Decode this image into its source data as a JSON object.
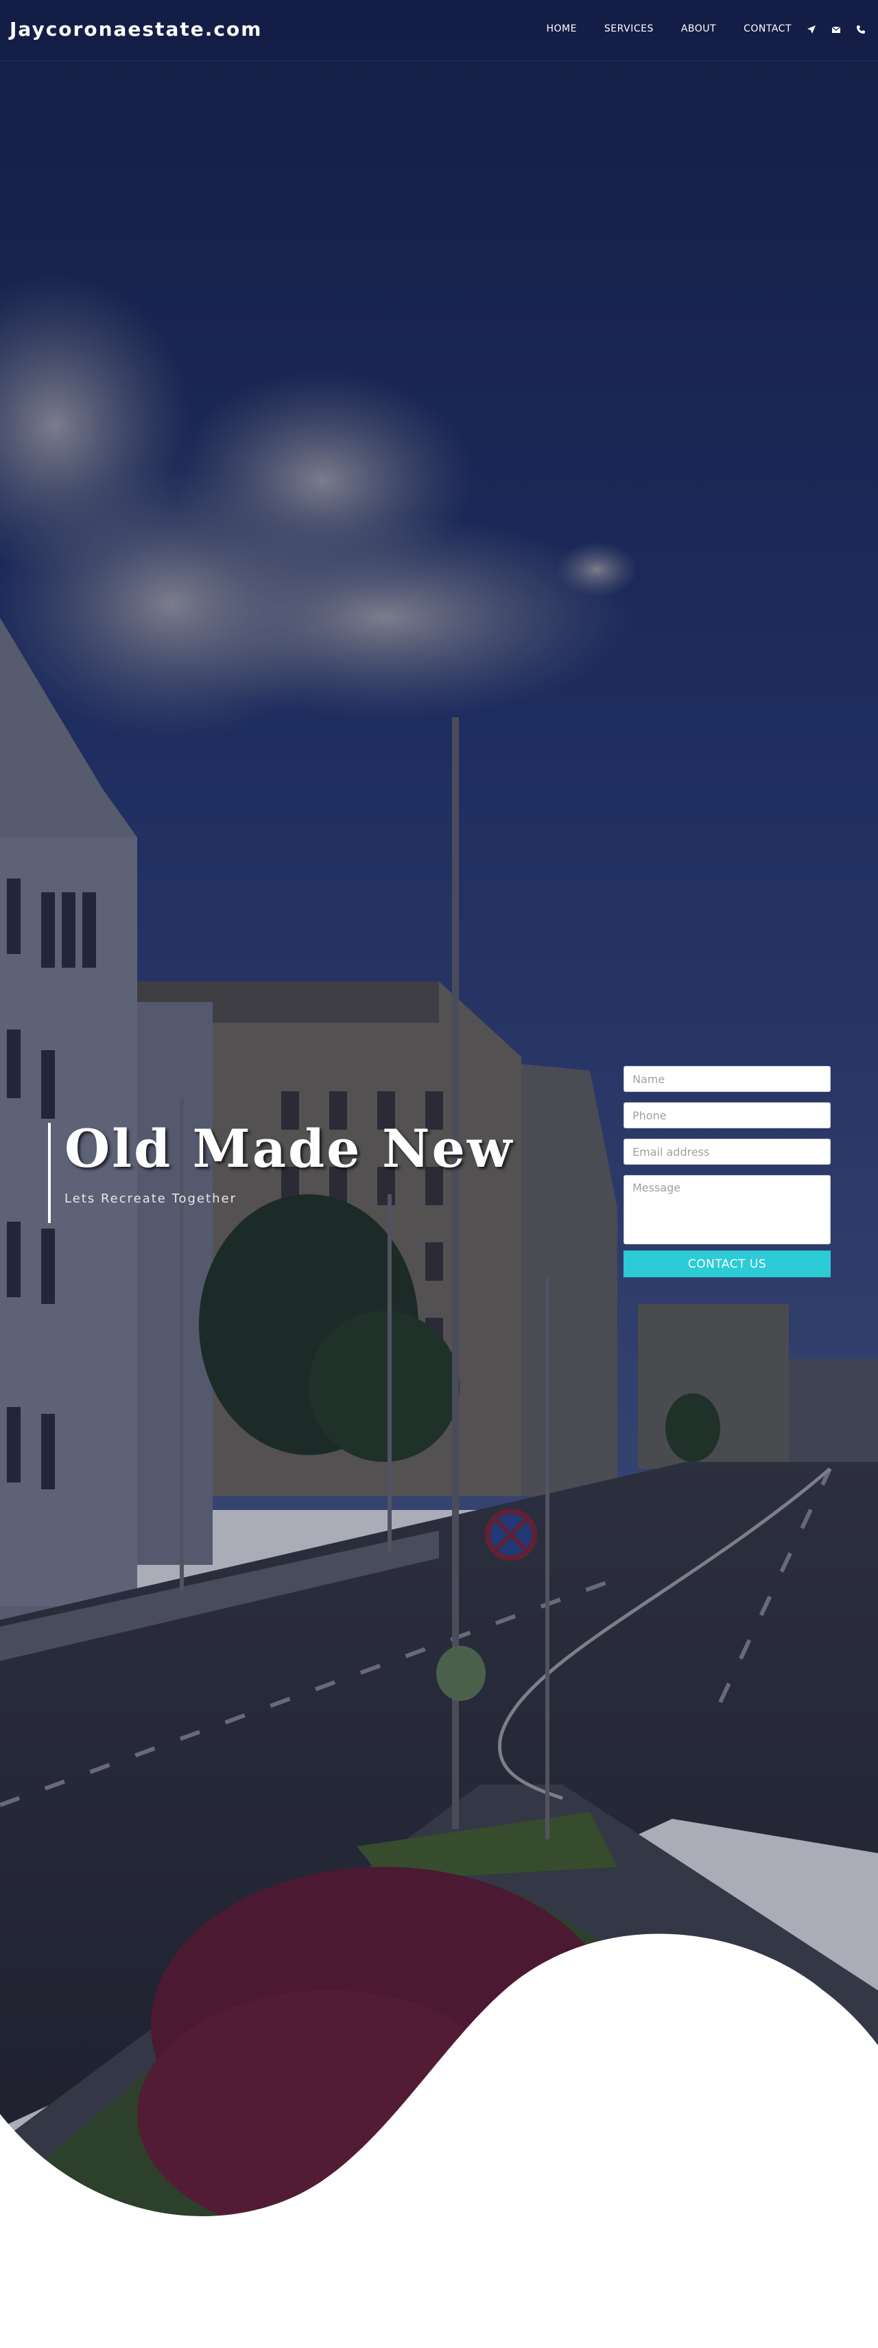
{
  "brand": "Jaycoronaestate.com",
  "nav": {
    "items": [
      {
        "label": "HOME"
      },
      {
        "label": "SERVICES"
      },
      {
        "label": "ABOUT"
      },
      {
        "label": "CONTACT"
      }
    ],
    "icons": [
      "location-arrow-icon",
      "envelope-icon",
      "phone-icon"
    ]
  },
  "hero": {
    "title": "Old Made New",
    "subtitle": "Lets Recreate Together"
  },
  "form": {
    "name_placeholder": "Name",
    "phone_placeholder": "Phone",
    "email_placeholder": "Email address",
    "message_placeholder": "Message",
    "submit_label": "CONTACT US"
  },
  "colors": {
    "accent": "#2ccbd6",
    "overlay": "#1a2a5e"
  }
}
